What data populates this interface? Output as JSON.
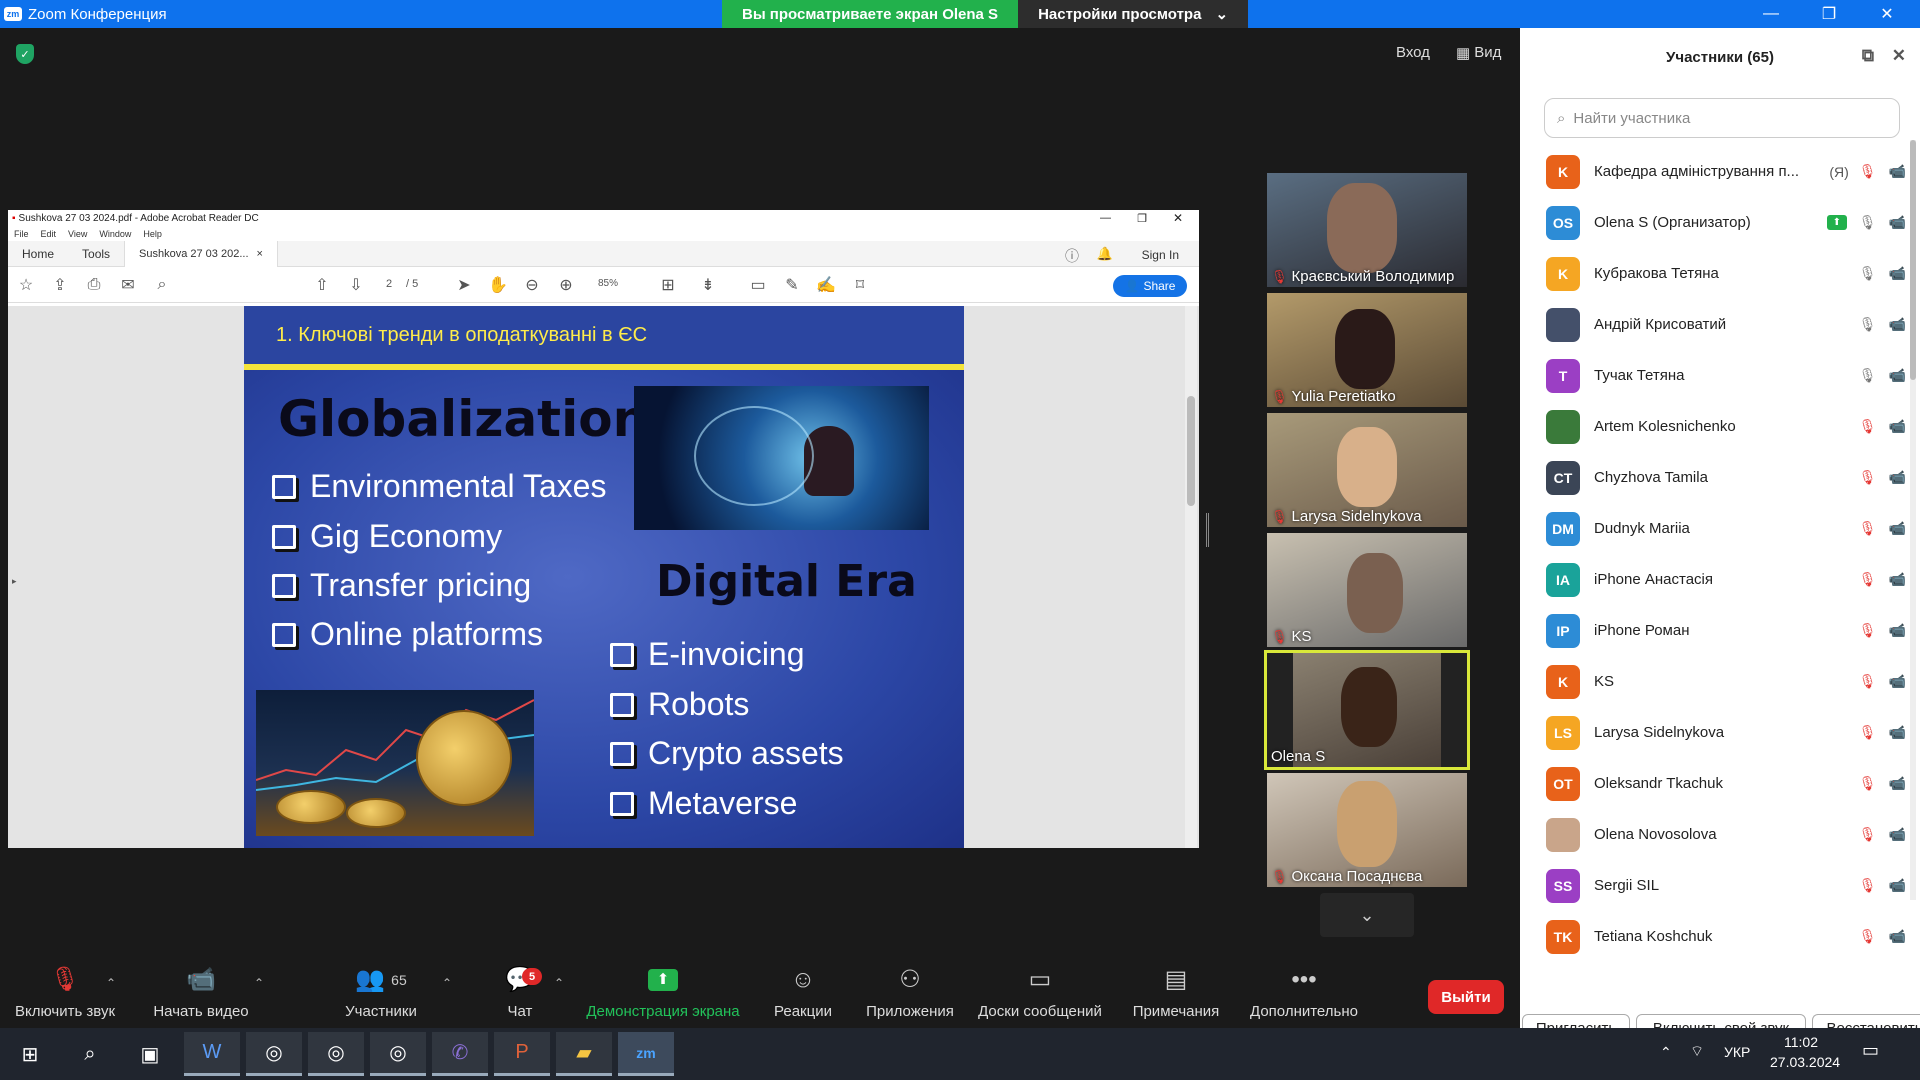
{
  "window": {
    "title": "Zoom Конференция",
    "viewing_banner": "Вы просматриваете экран Olena S",
    "view_settings": "Настройки просмотра"
  },
  "topright": {
    "login": "Вход",
    "view": "Вид"
  },
  "acrobat": {
    "title": "Sushkova 27 03 2024.pdf - Adobe Acrobat Reader DC",
    "menu": [
      "File",
      "Edit",
      "View",
      "Window",
      "Help"
    ],
    "tabs": {
      "home": "Home",
      "tools": "Tools",
      "doc": "Sushkova 27 03 202..."
    },
    "sign_in": "Sign In",
    "page_current": "2",
    "page_total": "/ 5",
    "zoom": "85%",
    "share": "Share"
  },
  "slide": {
    "header": "1. Ключові тренди в оподаткуванні в ЄС",
    "left_title": "Globalization",
    "left_items": [
      "Environmental Taxes",
      "Gig Economy",
      "Transfer pricing",
      "Online platforms"
    ],
    "right_title": "Digital Era",
    "right_items": [
      "E-invoicing",
      "Robots",
      "Crypto assets",
      "Metaverse"
    ]
  },
  "videos": [
    {
      "name": "Краєвський Володимир",
      "muted": true
    },
    {
      "name": "Yulia Peretiatko",
      "muted": true
    },
    {
      "name": "Larysa Sidelnykova",
      "muted": true
    },
    {
      "name": "KS",
      "muted": true
    },
    {
      "name": "Olena S",
      "muted": false,
      "active": true
    },
    {
      "name": "Оксана Посаднєва",
      "muted": true
    }
  ],
  "sidebar": {
    "title": "Участники (65)",
    "search_placeholder": "Найти участника",
    "participants": [
      {
        "initials": "K",
        "name": "Кафедра адміністрування п...",
        "tag": "(Я)",
        "color": "#e8621a",
        "mic": "off",
        "cam": "off"
      },
      {
        "initials": "OS",
        "name": "Olena S (Организатор)",
        "tag": "",
        "color": "#2d8cd6",
        "mic": "on",
        "cam": "on",
        "sharing": true
      },
      {
        "initials": "K",
        "name": "Кубракова Тетяна",
        "tag": "",
        "color": "#f5a623",
        "mic": "on",
        "cam": "off"
      },
      {
        "initials": "",
        "name": "Андрій Крисоватий",
        "tag": "",
        "color": "#44506a",
        "mic": "on",
        "cam": "off",
        "photo": true
      },
      {
        "initials": "T",
        "name": "Тучак Тетяна",
        "tag": "",
        "color": "#9b3fc4",
        "mic": "on",
        "cam": "off"
      },
      {
        "initials": "",
        "name": "Artem Kolesnichenko",
        "tag": "",
        "color": "#3a7a3a",
        "mic": "off",
        "cam": "off",
        "photo": true
      },
      {
        "initials": "CT",
        "name": "Chyzhova Tamila",
        "tag": "",
        "color": "#3b4556",
        "mic": "off",
        "cam": "on"
      },
      {
        "initials": "DM",
        "name": "Dudnyk Mariia",
        "tag": "",
        "color": "#2d8cd6",
        "mic": "off",
        "cam": "off"
      },
      {
        "initials": "IA",
        "name": "iPhone Анастасія",
        "tag": "",
        "color": "#1aa39a",
        "mic": "off",
        "cam": "off"
      },
      {
        "initials": "IP",
        "name": "iPhone Роман",
        "tag": "",
        "color": "#2d8cd6",
        "mic": "off",
        "cam": "off"
      },
      {
        "initials": "K",
        "name": "KS",
        "tag": "",
        "color": "#e8621a",
        "mic": "off",
        "cam": "on"
      },
      {
        "initials": "LS",
        "name": "Larysa Sidelnykova",
        "tag": "",
        "color": "#f5a623",
        "mic": "off",
        "cam": "on"
      },
      {
        "initials": "OT",
        "name": "Oleksandr Tkachuk",
        "tag": "",
        "color": "#e8621a",
        "mic": "off",
        "cam": "off"
      },
      {
        "initials": "",
        "name": "Olena Novosolova",
        "tag": "",
        "color": "#c9a58a",
        "mic": "off",
        "cam": "off",
        "photo": true
      },
      {
        "initials": "SS",
        "name": "Sergii SIL",
        "tag": "",
        "color": "#9b3fc4",
        "mic": "off",
        "cam": "off"
      },
      {
        "initials": "TK",
        "name": "Tetiana Koshchuk",
        "tag": "",
        "color": "#e8621a",
        "mic": "off",
        "cam": "off"
      }
    ],
    "buttons": {
      "invite": "Пригласить",
      "unmute": "Включить свой звук",
      "restore": "Восстановить"
    }
  },
  "toolbar": {
    "audio": "Включить звук",
    "video": "Начать видео",
    "participants": "Участники",
    "participants_count": "65",
    "chat": "Чат",
    "chat_badge": "5",
    "share": "Демонстрация экрана",
    "reactions": "Реакции",
    "apps": "Приложения",
    "whiteboards": "Доски сообщений",
    "notes": "Примечания",
    "more": "Дополнительно",
    "leave": "Выйти"
  },
  "taskbar": {
    "lang": "УКР",
    "time": "11:02",
    "date": "27.03.2024"
  }
}
